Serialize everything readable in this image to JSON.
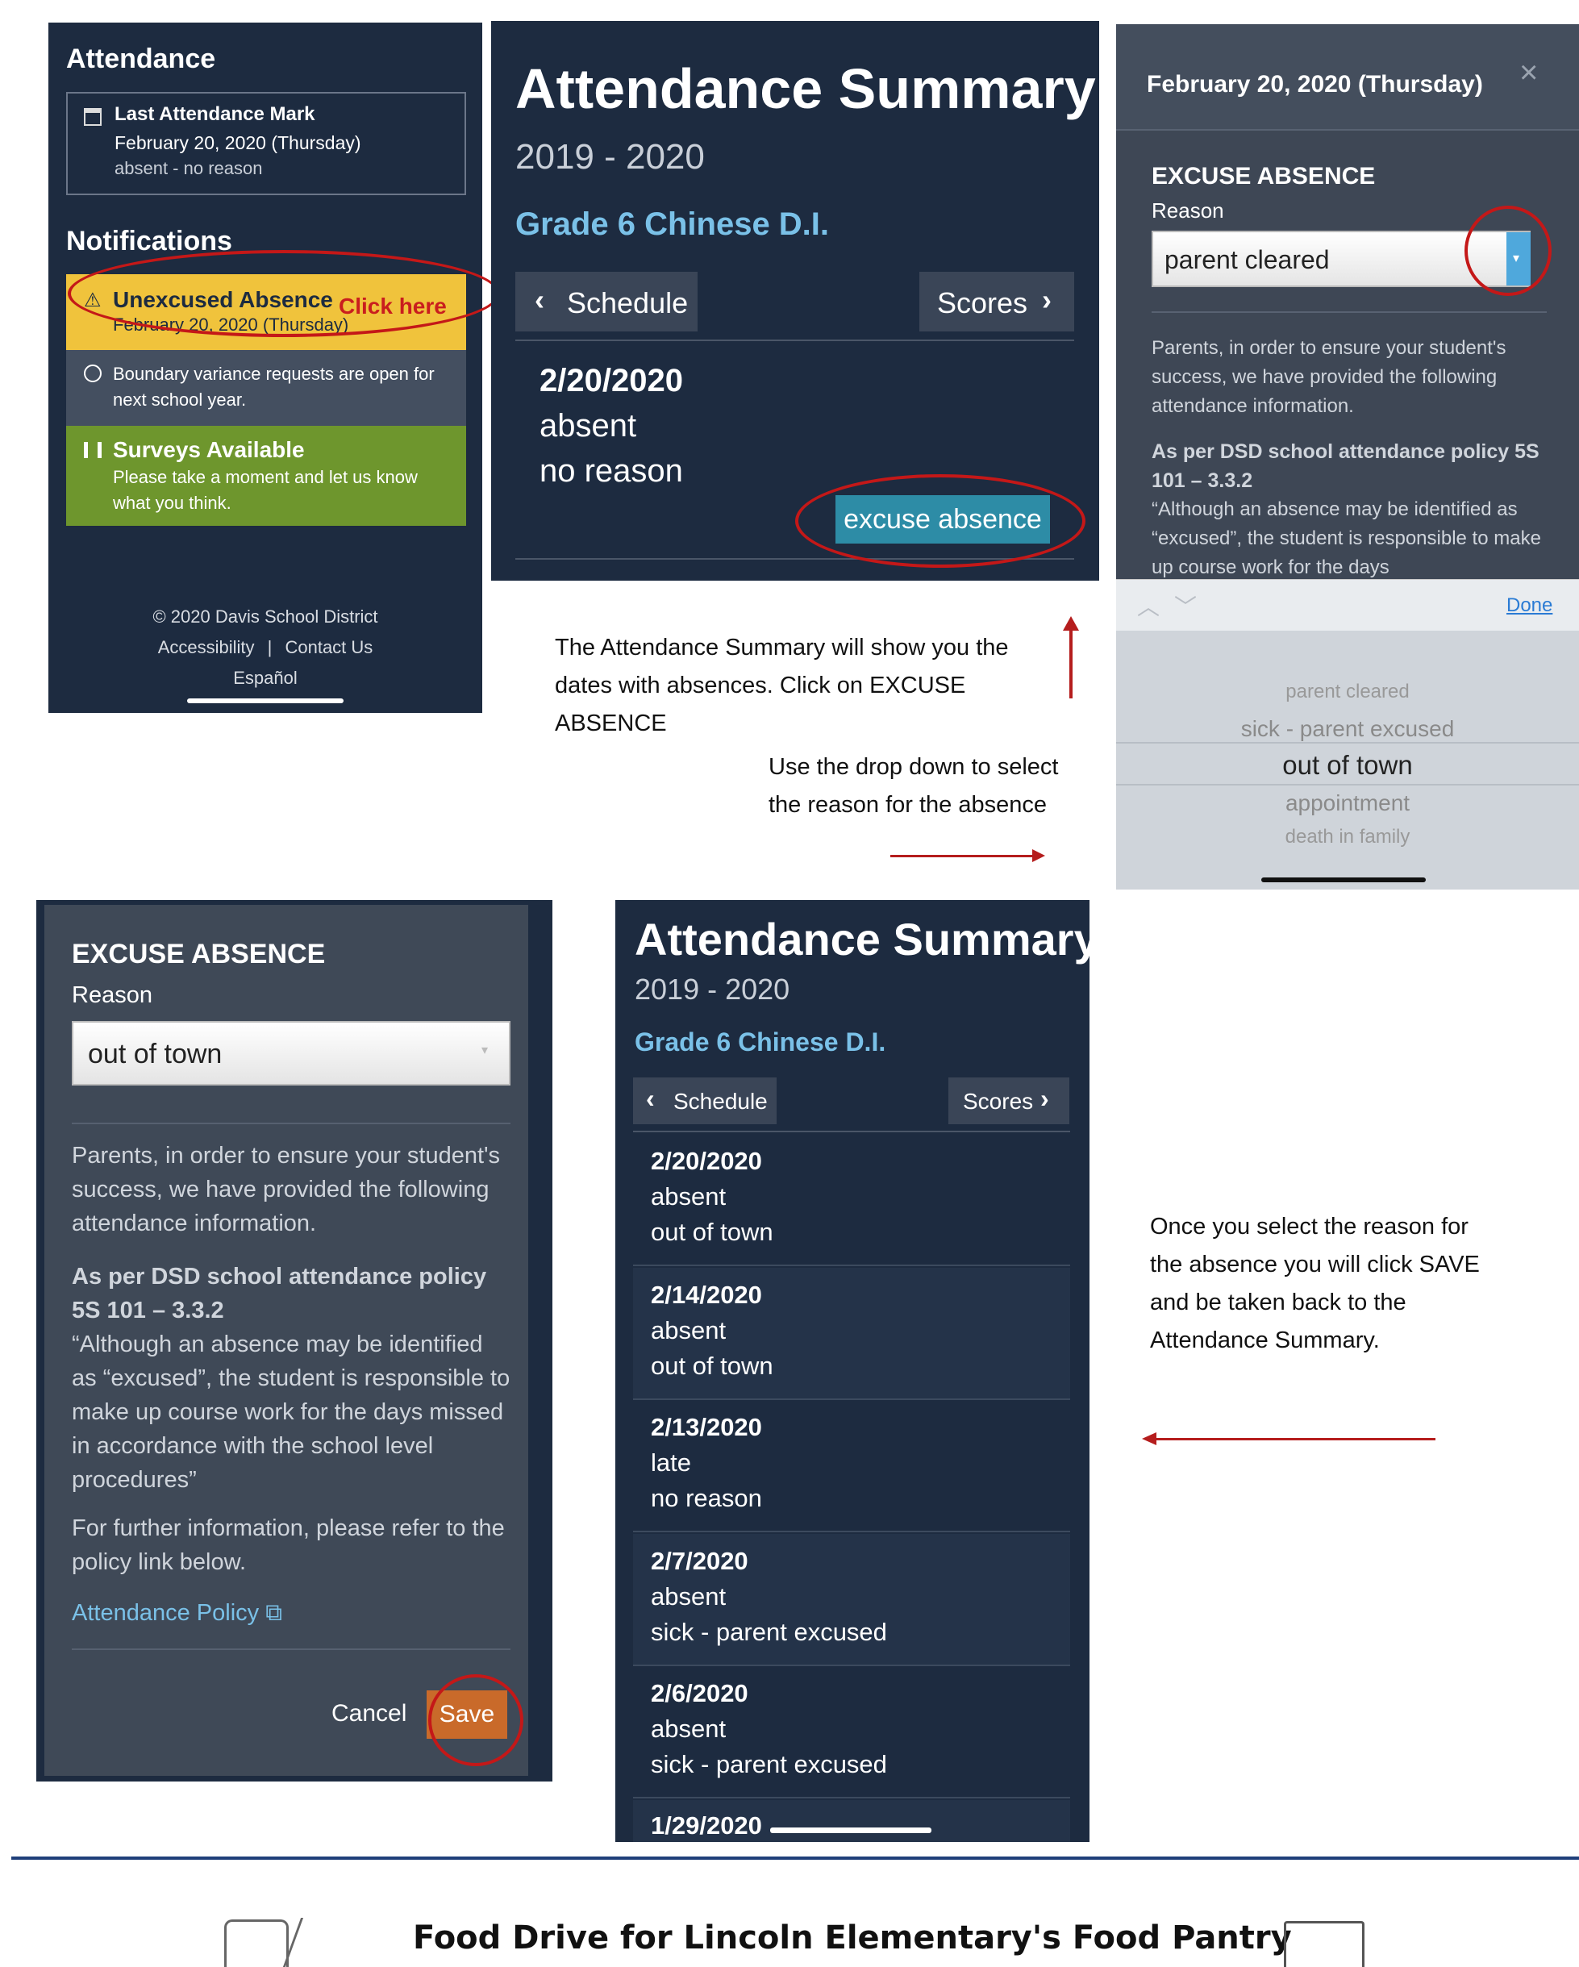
{
  "panel1": {
    "attendance_heading": "Attendance",
    "last_mark_title": "Last Attendance Mark",
    "last_mark_date": "February 20, 2020 (Thursday)",
    "last_mark_status": "absent - no reason",
    "notifications_heading": "Notifications",
    "unexcused_title": "Unexcused Absence",
    "unexcused_date": "February 20, 2020 (Thursday)",
    "click_here": "Click here",
    "boundary_text": "Boundary variance requests are open for next school year.",
    "surveys_title": "Surveys Available",
    "surveys_text": "Please take a moment and let us know what you think.",
    "footer_copyright": "© 2020 Davis School District",
    "footer_accessibility": "Accessibility",
    "footer_sep": "|",
    "footer_contact": "Contact Us",
    "footer_espanol": "Español"
  },
  "panel2": {
    "title": "Attendance Summary",
    "year": "2019 - 2020",
    "grade": "Grade 6 Chinese D.I.",
    "schedule_label": "Schedule",
    "scores_label": "Scores",
    "date": "2/20/2020",
    "status": "absent",
    "reason": "no reason",
    "excuse_button": "excuse absence"
  },
  "panel3": {
    "date_header": "February 20, 2020 (Thursday)",
    "close_symbol": "×",
    "excuse_heading": "EXCUSE ABSENCE",
    "reason_label": "Reason",
    "select_value": "parent cleared",
    "para1": "Parents, in order to ensure your student's success, we have provided the following attendance information.",
    "policy_heading": "As per DSD school attendance policy 5S 101 – 3.3.2",
    "policy_quote": "“Although an absence may be identified as “excused”, the student is responsible to make up course work for the days",
    "done_label": "Done",
    "picker_options": [
      "parent cleared",
      "sick - parent excused",
      "out of town",
      "appointment",
      "death in family"
    ]
  },
  "captions": {
    "summary_caption": "The Attendance Summary will show you the dates with absences. Click on EXCUSE ABSENCE",
    "dropdown_caption": "Use the drop down to select the reason for the absence",
    "save_caption": "Once you select the reason for the absence you will click SAVE and be taken back to the Attendance Summary."
  },
  "panel4": {
    "excuse_heading": "EXCUSE ABSENCE",
    "reason_label": "Reason",
    "select_value": "out of town",
    "para1": "Parents, in order to ensure your student's success, we have provided the following attendance information.",
    "policy_heading": "As per DSD school attendance policy 5S 101 – 3.3.2",
    "policy_quote": "“Although an absence may be identified as “excused”, the student is responsible to make up course work for the days missed in accordance with the school level procedures”",
    "further_info": "For further information, please refer to the policy link below.",
    "policy_link": "Attendance Policy",
    "cancel_label": "Cancel",
    "save_label": "Save"
  },
  "panel5": {
    "title": "Attendance Summary",
    "year": "2019 - 2020",
    "grade": "Grade 6 Chinese D.I.",
    "schedule_label": "Schedule",
    "scores_label": "Scores",
    "records": [
      {
        "date": "2/20/2020",
        "status": "absent",
        "reason": "out of town"
      },
      {
        "date": "2/14/2020",
        "status": "absent",
        "reason": "out of town"
      },
      {
        "date": "2/13/2020",
        "status": "late",
        "reason": "no reason"
      },
      {
        "date": "2/7/2020",
        "status": "absent",
        "reason": "sick - parent excused"
      },
      {
        "date": "2/6/2020",
        "status": "absent",
        "reason": "sick - parent excused"
      },
      {
        "date": "1/29/2020",
        "status": "",
        "reason": ""
      }
    ]
  },
  "footer": {
    "food_drive_title": "Food Drive for Lincoln Elementary's Food Pantry"
  }
}
